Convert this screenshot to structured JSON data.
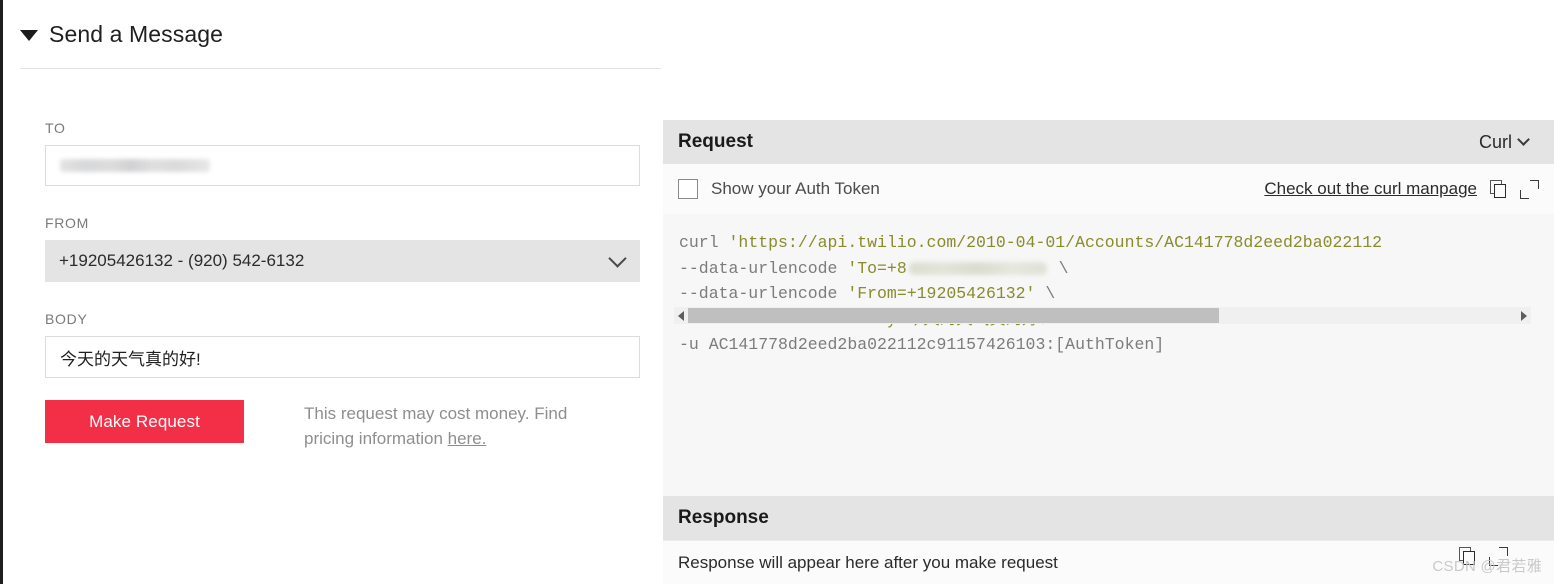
{
  "section": {
    "title": "Send a Message",
    "caret_icon": "caret-down-icon",
    "expanded": true
  },
  "form": {
    "to": {
      "label": "TO",
      "value": "",
      "redacted": true,
      "placeholder": ""
    },
    "from": {
      "label": "FROM",
      "value": "+19205426132 - (920) 542-6132",
      "chevron_icon": "chevron-down-icon"
    },
    "body": {
      "label": "BODY",
      "value": "今天的天气真的好!",
      "placeholder": ""
    },
    "submit_label": "Make Request",
    "submit_color": "#F22F46",
    "cost_note_text": "This request may cost money. Find pricing information ",
    "cost_note_link": "here."
  },
  "request_panel": {
    "title": "Request",
    "format_label": "Curl",
    "format_chevron_icon": "chevron-down-icon",
    "auth_token_label": "Show your Auth Token",
    "auth_token_checked": false,
    "manpage_link": "Check out the curl manpage",
    "copy_icon": "copy-icon",
    "expand_icon": "expand-icon",
    "code": {
      "language": "curl",
      "lines": [
        {
          "segments": [
            {
              "text": "curl ",
              "style": "plain"
            },
            {
              "text": "'https://api.twilio.com/2010-04-01/Accounts/AC141778d2eed2ba022112",
              "style": "string"
            }
          ]
        },
        {
          "segments": [
            {
              "text": "--data-urlencode ",
              "style": "plain"
            },
            {
              "text": "'To=+8",
              "style": "string"
            },
            {
              "text": "",
              "style": "redacted"
            },
            {
              "text": " \\",
              "style": "plain"
            }
          ]
        },
        {
          "segments": [
            {
              "text": "--data-urlencode ",
              "style": "plain"
            },
            {
              "text": "'From=+19205426132'",
              "style": "string"
            },
            {
              "text": " \\",
              "style": "plain"
            }
          ]
        },
        {
          "segments": [
            {
              "text": "--data-urlencode ",
              "style": "plain"
            },
            {
              "text": "'Body=今天的天气真的好！'",
              "style": "string"
            },
            {
              "text": " \\",
              "style": "plain"
            }
          ]
        },
        {
          "segments": [
            {
              "text": "-u AC141778d2eed2ba022112c91157426103:[AuthToken]",
              "style": "plain"
            }
          ]
        }
      ]
    },
    "scrollbar": {
      "left_arrow_icon": "scroll-left-arrow-icon",
      "right_arrow_icon": "scroll-right-arrow-icon",
      "thumb_percent": 64
    }
  },
  "response_panel": {
    "title": "Response",
    "empty_message": "Response will appear here after you make request"
  },
  "watermark": {
    "text": "CSDN @君若雅"
  }
}
